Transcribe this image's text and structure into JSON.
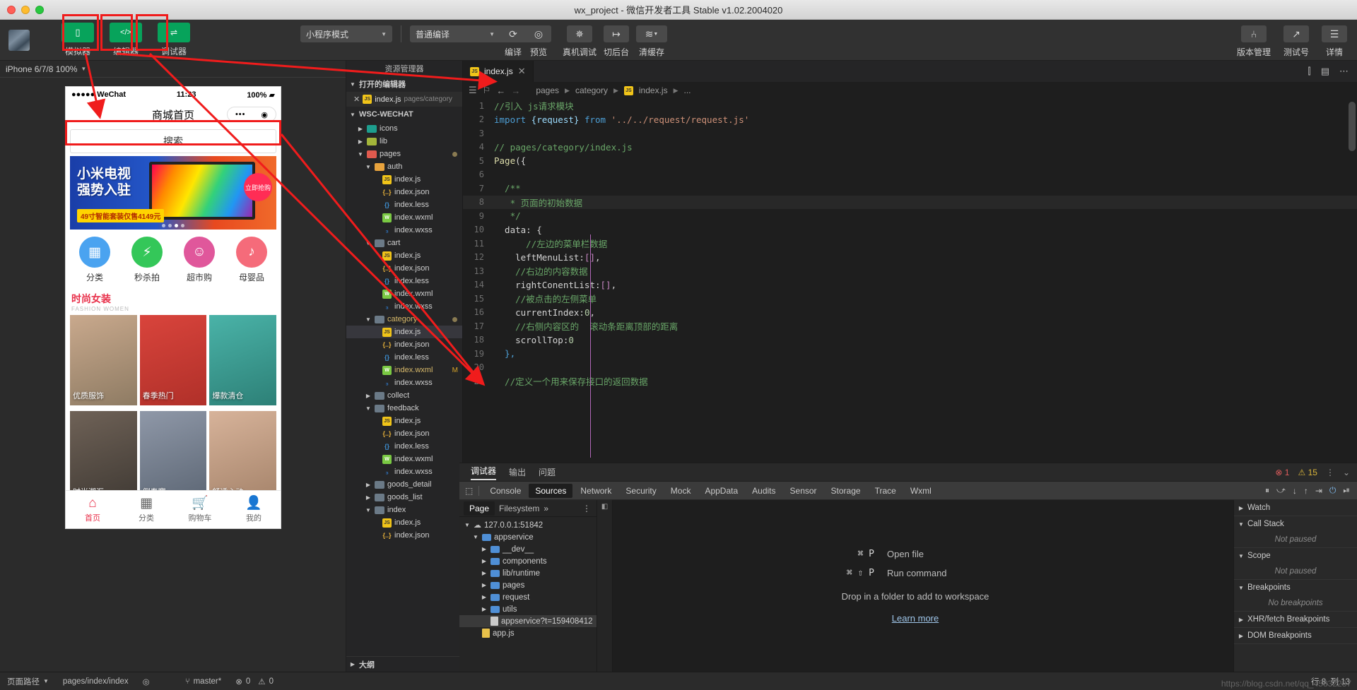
{
  "window": {
    "title": "wx_project - 微信开发者工具 Stable v1.02.2004020"
  },
  "toolbar": {
    "buttons": [
      {
        "label": "模拟器",
        "icon": "simulator-icon",
        "glyph": "▯"
      },
      {
        "label": "编辑器",
        "icon": "editor-icon",
        "glyph": "</>"
      },
      {
        "label": "调试器",
        "icon": "debugger-icon",
        "glyph": "⇌"
      }
    ],
    "mode_select": "小程序模式",
    "compile_select": "普通编译",
    "actions": [
      {
        "label": "编译",
        "icon": "refresh-icon",
        "glyph": "⟳"
      },
      {
        "label": "预览",
        "icon": "eye-icon",
        "glyph": "◉"
      },
      {
        "label": "真机调试",
        "icon": "bug-icon",
        "glyph": "🕷"
      },
      {
        "label": "切后台",
        "icon": "background-icon",
        "glyph": "↦"
      },
      {
        "label": "清缓存",
        "icon": "layers-icon",
        "glyph": "≋"
      }
    ],
    "right_actions": [
      {
        "label": "版本管理",
        "icon": "branch-icon",
        "glyph": "⑃"
      },
      {
        "label": "测试号",
        "icon": "external-link-icon",
        "glyph": "↗"
      },
      {
        "label": "详情",
        "icon": "hamburger-icon",
        "glyph": "☰"
      }
    ]
  },
  "simulator": {
    "device": "iPhone 6/7/8 100%",
    "phone": {
      "carrier": "●●●●● WeChat",
      "time": "11:23",
      "battery": "100%",
      "nav_title": "商城首页",
      "search_placeholder": "搜索",
      "banner": {
        "line1": "小米电视",
        "line2": "强势入驻",
        "sub": "49寸智能套装仅售4149元",
        "badge": "立即抢购"
      },
      "categories": [
        {
          "label": "分类",
          "color": "#4aa3f0",
          "glyph": "▦"
        },
        {
          "label": "秒杀拍",
          "color": "#34c759",
          "glyph": "⚡"
        },
        {
          "label": "超市购",
          "color": "#e0579b",
          "glyph": "☺"
        },
        {
          "label": "母婴品",
          "color": "#f56b7a",
          "glyph": "♪"
        }
      ],
      "section": {
        "title": "时尚女装",
        "subtitle": "FASHION WOMEN"
      },
      "grid_row1": [
        {
          "caption": "优质服饰",
          "c1": "#c9a98d",
          "c2": "#8e7b63"
        },
        {
          "caption": "春季热门",
          "c1": "#d9443c",
          "c2": "#b03029"
        },
        {
          "caption": "爆款清仓",
          "c1": "#4ab3a8",
          "c2": "#2d8077"
        }
      ],
      "grid_row2": [
        {
          "caption": "时尚潮汇",
          "c1": "#6f6257",
          "c2": "#403a34"
        },
        {
          "caption": "倒春寒",
          "c1": "#8f98a8",
          "c2": "#5c6674"
        },
        {
          "caption": "舒适心动",
          "c1": "#d7b39a",
          "c2": "#a5836a"
        }
      ],
      "tabs": [
        {
          "label": "首页",
          "glyph": "⌂",
          "active": true
        },
        {
          "label": "分类",
          "glyph": "▦",
          "active": false
        },
        {
          "label": "购物车",
          "glyph": "🛒",
          "active": false
        },
        {
          "label": "我的",
          "glyph": "👤",
          "active": false
        }
      ]
    }
  },
  "explorer": {
    "title": "资源管理器",
    "open_editors_label": "打开的编辑器",
    "open_editor": {
      "name": "index.js",
      "path": "pages/category"
    },
    "project_label": "WSC-WECHAT",
    "tree": [
      {
        "depth": 1,
        "name": "icons",
        "type": "folder",
        "color": "f-teal",
        "state": "collapsed"
      },
      {
        "depth": 1,
        "name": "lib",
        "type": "folder",
        "color": "f-olive",
        "state": "collapsed"
      },
      {
        "depth": 1,
        "name": "pages",
        "type": "folder",
        "color": "f-red",
        "state": "expanded",
        "marker": "dot"
      },
      {
        "depth": 2,
        "name": "auth",
        "type": "folder",
        "color": "f-orange",
        "state": "expanded"
      },
      {
        "depth": 3,
        "name": "index.js",
        "type": "js"
      },
      {
        "depth": 3,
        "name": "index.json",
        "type": "json"
      },
      {
        "depth": 3,
        "name": "index.less",
        "type": "less"
      },
      {
        "depth": 3,
        "name": "index.wxml",
        "type": "wxml"
      },
      {
        "depth": 3,
        "name": "index.wxss",
        "type": "wxss"
      },
      {
        "depth": 2,
        "name": "cart",
        "type": "folder",
        "color": "f-gray",
        "state": "expanded"
      },
      {
        "depth": 3,
        "name": "index.js",
        "type": "js"
      },
      {
        "depth": 3,
        "name": "index.json",
        "type": "json"
      },
      {
        "depth": 3,
        "name": "index.less",
        "type": "less"
      },
      {
        "depth": 3,
        "name": "index.wxml",
        "type": "wxml"
      },
      {
        "depth": 3,
        "name": "index.wxss",
        "type": "wxss"
      },
      {
        "depth": 2,
        "name": "category",
        "type": "folder",
        "color": "f-gray",
        "state": "expanded",
        "marker": "dot",
        "highlight": true
      },
      {
        "depth": 3,
        "name": "index.js",
        "type": "js",
        "selected": true
      },
      {
        "depth": 3,
        "name": "index.json",
        "type": "json"
      },
      {
        "depth": 3,
        "name": "index.less",
        "type": "less"
      },
      {
        "depth": 3,
        "name": "index.wxml",
        "type": "wxml",
        "modified": "M",
        "highlight": true
      },
      {
        "depth": 3,
        "name": "index.wxss",
        "type": "wxss"
      },
      {
        "depth": 2,
        "name": "collect",
        "type": "folder",
        "color": "f-gray",
        "state": "collapsed"
      },
      {
        "depth": 2,
        "name": "feedback",
        "type": "folder",
        "color": "f-gray",
        "state": "expanded"
      },
      {
        "depth": 3,
        "name": "index.js",
        "type": "js"
      },
      {
        "depth": 3,
        "name": "index.json",
        "type": "json"
      },
      {
        "depth": 3,
        "name": "index.less",
        "type": "less"
      },
      {
        "depth": 3,
        "name": "index.wxml",
        "type": "wxml"
      },
      {
        "depth": 3,
        "name": "index.wxss",
        "type": "wxss"
      },
      {
        "depth": 2,
        "name": "goods_detail",
        "type": "folder",
        "color": "f-gray",
        "state": "collapsed"
      },
      {
        "depth": 2,
        "name": "goods_list",
        "type": "folder",
        "color": "f-gray",
        "state": "collapsed"
      },
      {
        "depth": 2,
        "name": "index",
        "type": "folder",
        "color": "f-gray",
        "state": "expanded"
      },
      {
        "depth": 3,
        "name": "index.js",
        "type": "js"
      },
      {
        "depth": 3,
        "name": "index.json",
        "type": "json"
      }
    ],
    "outline_label": "大纲"
  },
  "editor": {
    "tab": {
      "name": "index.js",
      "close": "✕"
    },
    "breadcrumb": [
      "pages",
      "category",
      "index.js",
      "..."
    ],
    "lines": [
      {
        "n": 1,
        "tokens": [
          {
            "t": "//引入 js请求模块",
            "c": "cmt"
          }
        ]
      },
      {
        "n": 2,
        "tokens": [
          {
            "t": "import",
            "c": "kw"
          },
          {
            "t": " {request} ",
            "c": "prop"
          },
          {
            "t": "from",
            "c": "kw"
          },
          {
            "t": " ",
            "c": "pun"
          },
          {
            "t": "'../../request/request.js'",
            "c": "str"
          }
        ]
      },
      {
        "n": 3,
        "tokens": []
      },
      {
        "n": 4,
        "tokens": [
          {
            "t": "// pages/category/index.js",
            "c": "cmt"
          }
        ]
      },
      {
        "n": 5,
        "tokens": [
          {
            "t": "Page",
            "c": "fn"
          },
          {
            "t": "({",
            "c": "pun"
          }
        ]
      },
      {
        "n": 6,
        "tokens": []
      },
      {
        "n": 7,
        "tokens": [
          {
            "t": "  /**",
            "c": "cmt"
          }
        ]
      },
      {
        "n": 8,
        "tokens": [
          {
            "t": "   * 页面的初始数据",
            "c": "cmt"
          }
        ],
        "highlight": true
      },
      {
        "n": 9,
        "tokens": [
          {
            "t": "   */",
            "c": "cmt"
          }
        ]
      },
      {
        "n": 10,
        "tokens": [
          {
            "t": "  data",
            "c": "ct"
          },
          {
            "t": ": {",
            "c": "pun"
          }
        ]
      },
      {
        "n": 11,
        "tokens": [
          {
            "t": "      //左边的菜单栏数据",
            "c": "cmt"
          }
        ]
      },
      {
        "n": 12,
        "tokens": [
          {
            "t": "    leftMenuList",
            "c": "ct"
          },
          {
            "t": ":",
            "c": "pun"
          },
          {
            "t": "[]",
            "c": "brc"
          },
          {
            "t": ",",
            "c": "pun"
          }
        ]
      },
      {
        "n": 13,
        "tokens": [
          {
            "t": "    //右边的内容数据",
            "c": "cmt"
          }
        ]
      },
      {
        "n": 14,
        "tokens": [
          {
            "t": "    rightConentList",
            "c": "ct"
          },
          {
            "t": ":",
            "c": "pun"
          },
          {
            "t": "[]",
            "c": "brc"
          },
          {
            "t": ",",
            "c": "pun"
          }
        ]
      },
      {
        "n": 15,
        "tokens": [
          {
            "t": "    //被点击的左侧菜单",
            "c": "cmt"
          }
        ]
      },
      {
        "n": 16,
        "tokens": [
          {
            "t": "    currentIndex",
            "c": "ct"
          },
          {
            "t": ":",
            "c": "pun"
          },
          {
            "t": "0",
            "c": "num"
          },
          {
            "t": ",",
            "c": "pun"
          }
        ]
      },
      {
        "n": 17,
        "tokens": [
          {
            "t": "    //右侧内容区的  滚动条距离顶部的距离",
            "c": "cmt"
          }
        ]
      },
      {
        "n": 18,
        "tokens": [
          {
            "t": "    scrollTop",
            "c": "ct"
          },
          {
            "t": ":",
            "c": "pun"
          },
          {
            "t": "0",
            "c": "num"
          }
        ]
      },
      {
        "n": 19,
        "tokens": [
          {
            "t": "  },",
            "c": "kw"
          }
        ]
      },
      {
        "n": 20,
        "tokens": []
      },
      {
        "n": 21,
        "tokens": [
          {
            "t": "  //定义一个用来保存接口的返回数据",
            "c": "cmt"
          }
        ]
      }
    ]
  },
  "debugger": {
    "panel_tabs": [
      {
        "label": "调试器",
        "active": true
      },
      {
        "label": "输出",
        "active": false
      },
      {
        "label": "问题",
        "active": false
      }
    ],
    "errors": "1",
    "warnings": "15",
    "devtools_tabs": [
      {
        "label": "Console",
        "active": false
      },
      {
        "label": "Sources",
        "active": true
      },
      {
        "label": "Network",
        "active": false
      },
      {
        "label": "Security",
        "active": false
      },
      {
        "label": "Mock",
        "active": false
      },
      {
        "label": "AppData",
        "active": false
      },
      {
        "label": "Audits",
        "active": false
      },
      {
        "label": "Sensor",
        "active": false
      },
      {
        "label": "Storage",
        "active": false
      },
      {
        "label": "Trace",
        "active": false
      },
      {
        "label": "Wxml",
        "active": false
      }
    ],
    "sources": {
      "tabs": [
        {
          "label": "Page",
          "active": true
        },
        {
          "label": "Filesystem",
          "active": false
        },
        {
          "label": "»",
          "active": false
        }
      ],
      "tree": [
        {
          "depth": 0,
          "name": "127.0.0.1:51842",
          "type": "cloud",
          "state": "expanded"
        },
        {
          "depth": 1,
          "name": "appservice",
          "type": "folder",
          "state": "expanded"
        },
        {
          "depth": 2,
          "name": "__dev__",
          "type": "folder",
          "state": "collapsed"
        },
        {
          "depth": 2,
          "name": "components",
          "type": "folder",
          "state": "collapsed"
        },
        {
          "depth": 2,
          "name": "lib/runtime",
          "type": "folder",
          "state": "collapsed"
        },
        {
          "depth": 2,
          "name": "pages",
          "type": "folder",
          "state": "collapsed"
        },
        {
          "depth": 2,
          "name": "request",
          "type": "folder",
          "state": "collapsed"
        },
        {
          "depth": 2,
          "name": "utils",
          "type": "folder",
          "state": "collapsed"
        },
        {
          "depth": 2,
          "name": "appservice?t=159408412",
          "type": "file",
          "selected": true
        },
        {
          "depth": 1,
          "name": "app.js",
          "type": "file-yellow"
        }
      ]
    },
    "empty_state": {
      "rows": [
        {
          "key": "⌘ P",
          "action": "Open file"
        },
        {
          "key": "⌘ ⇧ P",
          "action": "Run command"
        }
      ],
      "drop_text": "Drop in a folder to add to workspace",
      "link": "Learn more"
    },
    "right_panel": [
      {
        "title": "Watch",
        "value": null
      },
      {
        "title": "Call Stack",
        "value": "Not paused"
      },
      {
        "title": "Scope",
        "value": "Not paused"
      },
      {
        "title": "Breakpoints",
        "value": "No breakpoints"
      },
      {
        "title": "XHR/fetch Breakpoints",
        "value": null
      },
      {
        "title": "DOM Breakpoints",
        "value": null
      }
    ]
  },
  "status_bar": {
    "page_path_label": "页面路径",
    "page_path": "pages/index/index",
    "branch": "master*",
    "errors": "0",
    "warnings": "0",
    "cursor": "行 8, 列 13",
    "watermark": "https://blog.csdn.net/qq_45832287"
  }
}
